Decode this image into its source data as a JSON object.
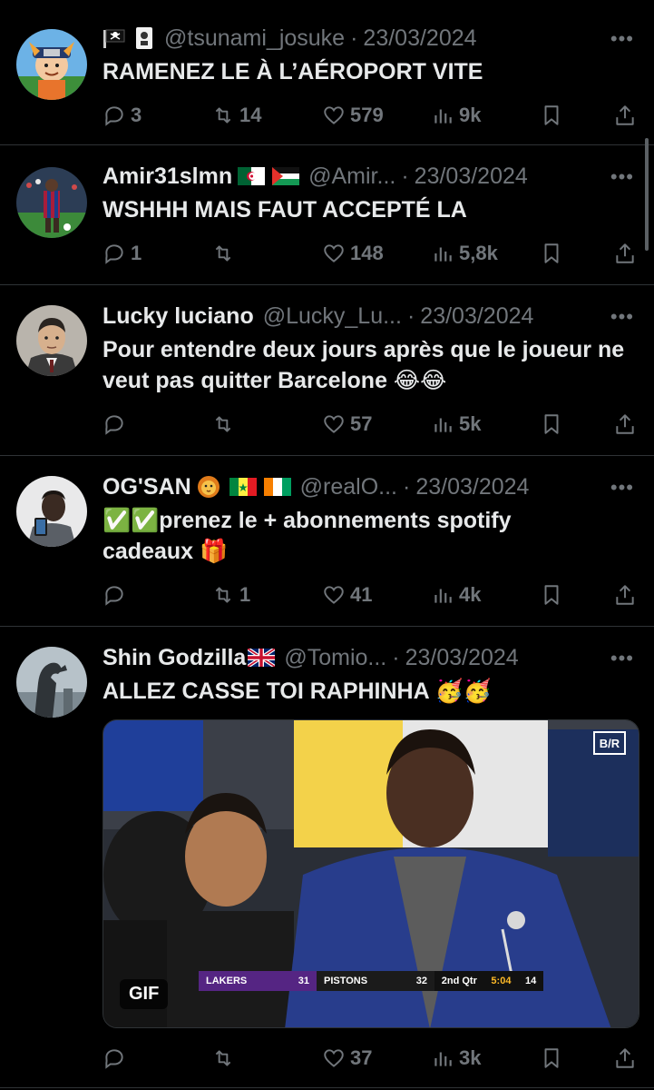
{
  "colors": {
    "background": "#000000",
    "text_primary": "#e7e9ea",
    "text_secondary": "#71767b",
    "divider": "#2f3336"
  },
  "tweets": [
    {
      "display_name": "",
      "name_icons": [
        "pirate-flag-icon",
        "card-icon"
      ],
      "handle": "@tsunami_josuke",
      "time": "23/03/2024",
      "text": "RAMENEZ LE À L’AÉROPORT VITE",
      "replies": "3",
      "retweets": "14",
      "likes": "579",
      "views": "9k"
    },
    {
      "display_name": "Amir31slmn",
      "name_icons": [
        "algeria-flag-icon",
        "palestine-flag-icon"
      ],
      "handle": "@Amir...",
      "time": "23/03/2024",
      "text": "WSHHH MAIS FAUT ACCEPTÉ LA",
      "replies": "1",
      "retweets": "",
      "likes": "148",
      "views": "5,8k"
    },
    {
      "display_name": "Lucky luciano",
      "name_icons": [],
      "handle": "@Lucky_Lu...",
      "time": "23/03/2024",
      "text": "Pour entendre deux jours après que le joueur ne veut pas quitter Barcelone 😂😂",
      "replies": "",
      "retweets": "",
      "likes": "57",
      "views": "5k"
    },
    {
      "display_name": "OG'SAN",
      "name_icons": [
        "lion-face-icon",
        "senegal-flag-icon",
        "ivory-coast-flag-icon"
      ],
      "handle": "@realO...",
      "time": "23/03/2024",
      "text": "✅✅prenez le + abonnements spotify cadeaux 🎁",
      "replies": "",
      "retweets": "1",
      "likes": "41",
      "views": "4k"
    },
    {
      "display_name": "Shin Godzilla",
      "name_icons": [
        "uk-flag-icon"
      ],
      "handle": "@Tomio...",
      "time": "23/03/2024",
      "text": "ALLEZ CASSE TOI RAPHINHA 🥳🥳",
      "replies": "",
      "retweets": "",
      "likes": "37",
      "views": "3k",
      "media": {
        "badge": "GIF",
        "logo": "B/R",
        "scoreboard": {
          "team1": "LAKERS",
          "score1": "31",
          "team2": "PISTONS",
          "score2": "32",
          "period": "2nd Qtr",
          "clock": "5:04",
          "shot_clock": "14"
        }
      }
    }
  ],
  "more_label": "•••",
  "separator": "·"
}
